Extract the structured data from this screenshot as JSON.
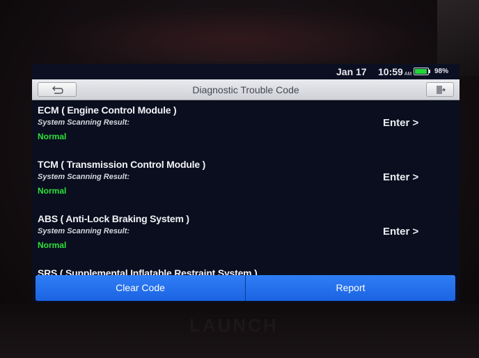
{
  "status": {
    "date": "Jan 17",
    "time": "10:59",
    "ampm": "AM",
    "battery_percent": "98%",
    "battery_level": 0.98,
    "battery_color": "#22d43a"
  },
  "header": {
    "title": "Diagnostic Trouble Code",
    "back_icon": "back-arrow-icon",
    "exit_icon": "exit-door-icon"
  },
  "modules": [
    {
      "name": "ECM ( Engine Control Module )",
      "result_label": "System Scanning Result:",
      "result": "Normal",
      "action": "Enter >"
    },
    {
      "name": "TCM ( Transmission Control Module )",
      "result_label": "System Scanning Result:",
      "result": "Normal",
      "action": "Enter >"
    },
    {
      "name": "ABS ( Anti-Lock Braking System )",
      "result_label": "System Scanning Result:",
      "result": "Normal",
      "action": "Enter >"
    },
    {
      "name": "SRS ( Supplemental Inflatable Restraint System )"
    }
  ],
  "footer": {
    "clear_label": "Clear Code",
    "report_label": "Report",
    "accent": "#2f7ef6"
  },
  "device": {
    "brand": "LAUNCH"
  },
  "colors": {
    "normal_status": "#2ee03c",
    "screen_bg": "#0a0e1e"
  }
}
